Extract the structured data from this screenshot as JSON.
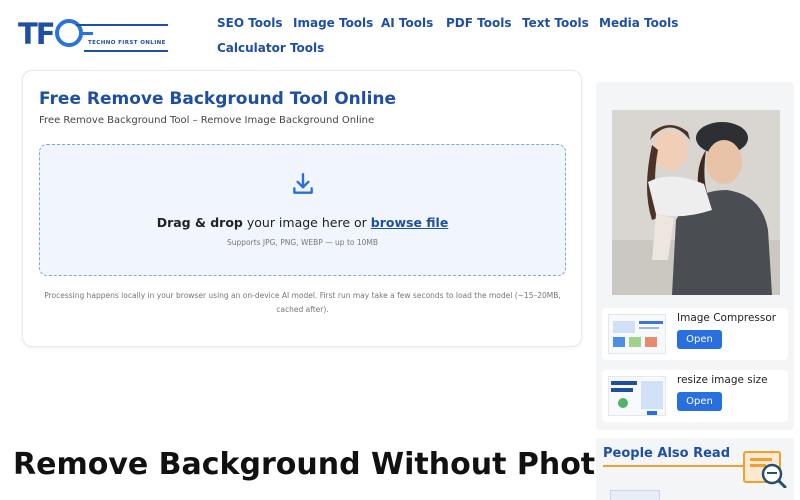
{
  "header": {
    "logo_text": "TFO",
    "logo_tagline": "TECHNO FIRST ONLINE",
    "nav": [
      "SEO Tools",
      "Image Tools",
      "AI Tools",
      "PDF Tools",
      "Text Tools",
      "Media Tools",
      "Calculator Tools"
    ]
  },
  "tool": {
    "title": "Free Remove Background Tool Online",
    "subtitle": "Free Remove Background Tool – Remove Image Background Online",
    "drop_bold": "Drag & drop",
    "drop_text": " your image here or ",
    "browse": "browse file",
    "hint": "Supports JPG, PNG, WEBP — up to 10MB",
    "note": "Processing happens locally in your browser using an on-device AI model. First run may take a few seconds to load the model (~15–20MB, cached after)."
  },
  "article": {
    "heading": "Remove Background Without Photoshop"
  },
  "sidebar": {
    "promos": [
      {
        "title": "Image Compressor",
        "button": "Open"
      },
      {
        "title": "resize image size",
        "button": "Open"
      }
    ],
    "people_also_read": "People Also Read"
  },
  "colors": {
    "brand": "#1e4fa3",
    "accent_button": "#2a6fe0",
    "dropzone_bg": "#f1f6fe",
    "underline": "#f0a030"
  }
}
